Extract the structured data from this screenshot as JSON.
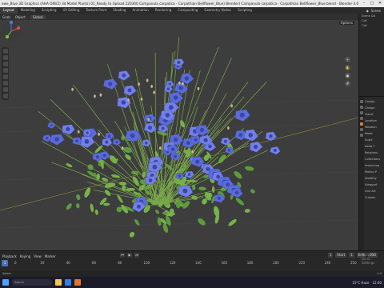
{
  "window": {
    "title": "ewe_Blue 3D Graphics (AHA ONV2) 3d Model Plants) 01_Ready to Upload 220300 Campanula carpatica - Carpathian Bellflower_Blue) Blender) Campanula carpatica - Carpathian Bellflower_Blue.blend - Blender 4.0"
  },
  "workspaces": [
    "Layout",
    "Modeling",
    "Sculpting",
    "UV Editing",
    "Texture Paint",
    "Shading",
    "Animation",
    "Rendering",
    "Compositing",
    "Geometry Nodes",
    "Scripting"
  ],
  "active_workspace": "Layout",
  "scene_label": "Scene",
  "header_menu": [
    "Object",
    "Global"
  ],
  "header_menu_left": [
    "Grab",
    "Object"
  ],
  "viewport": {
    "options_label": "Options"
  },
  "outliner": {
    "rows": [
      "Scene Col",
      "Coll",
      "Coll"
    ]
  },
  "properties": {
    "rows": [
      "Campa",
      "Campa",
      "Transf",
      "Location",
      "Rotation",
      "Mode",
      "Scale",
      "Delta T",
      "Relations",
      "Collections",
      "Instancing",
      "Motion P",
      "Visibility",
      "Viewport",
      "Line Art",
      "Custom"
    ]
  },
  "timeline": {
    "menus": [
      "Playback",
      "Keying",
      "View",
      "Marker"
    ],
    "current_frame": "1",
    "start_label": "Start",
    "start": "1",
    "end_label": "End",
    "end": "250",
    "ruler": [
      "0",
      "10",
      "40",
      "60",
      "80",
      "100",
      "120",
      "140",
      "160",
      "180",
      "200",
      "220",
      "240",
      "250"
    ]
  },
  "status": {
    "text": "Select",
    "version": "4.0"
  },
  "watermark": {
    "line1": "Activate",
    "line2": "Go to Settings"
  },
  "taskbar": {
    "search": "Search",
    "weather": "15°C Haze",
    "time": "12:00"
  },
  "colors": {
    "accent": "#4772b3",
    "flower": "#5b6bd8",
    "leaf": "#5c9a3c",
    "ui_bg": "#303030"
  }
}
